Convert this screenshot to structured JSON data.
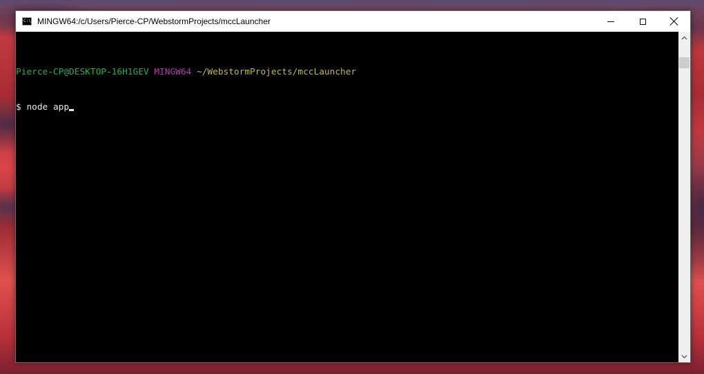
{
  "window": {
    "title": "MINGW64:/c/Users/Pierce-CP/WebstormProjects/mccLauncher",
    "controls": {
      "minimize": "minimize-icon",
      "maximize": "maximize-icon",
      "close": "close-icon"
    }
  },
  "terminal": {
    "prompt": {
      "user_host": "Pierce-CP@DESKTOP-16H1GEV",
      "system": "MINGW64",
      "path": "~/WebstormProjects/mccLauncher"
    },
    "command_line": {
      "symbol": "$",
      "command": "node app"
    }
  },
  "colors": {
    "prompt_user": "#1cb54a",
    "prompt_system": "#b639b6",
    "prompt_path": "#bfbf37",
    "text": "#e8e8e8",
    "background": "#000000"
  }
}
